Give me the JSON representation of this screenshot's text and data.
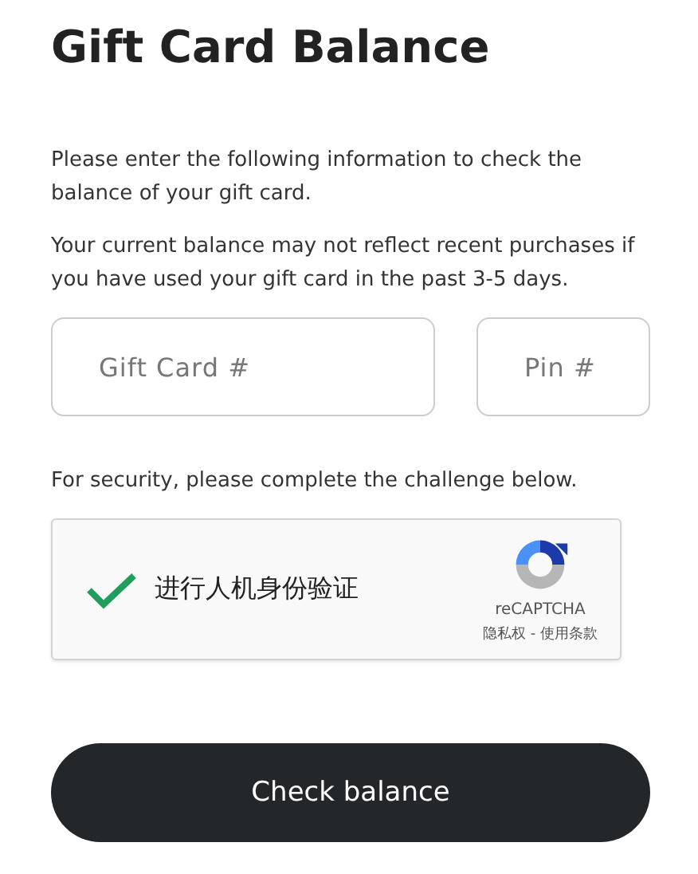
{
  "title": "Gift Card Balance",
  "paragraphs": [
    "Please enter the following information to check the balance of your gift card.",
    "Your current balance may not reflect recent purchases if you have used your gift card in the past 3-5 days."
  ],
  "fields": [
    {
      "placeholder": "Gift Card #"
    },
    {
      "placeholder": "Pin #"
    }
  ],
  "security_note": "For security, please complete the challenge below.",
  "captcha": {
    "checked": true,
    "label": "进行人机身份验证",
    "brand": "reCAPTCHA",
    "links": "隐私权 - 使用条款"
  },
  "button": "Check balance"
}
